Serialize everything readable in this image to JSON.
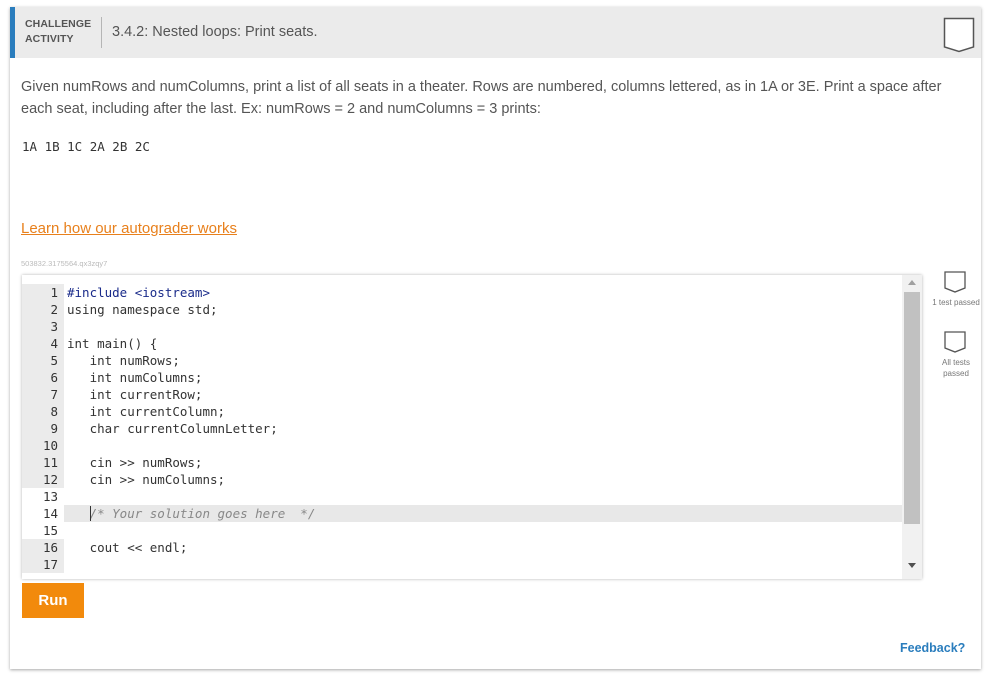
{
  "header": {
    "activity_type": "CHALLENGE ACTIVITY",
    "title": "3.4.2: Nested loops: Print seats.",
    "accent_color": "#2a7dbd"
  },
  "prompt": {
    "text": "Given numRows and numColumns, print a list of all seats in a theater. Rows are numbered, columns lettered, as in 1A or 3E. Print a space after each seat, including after the last. Ex: numRows = 2 and numColumns = 3 prints:",
    "example_output": "1A 1B 1C 2A 2B 2C",
    "learn_link": "Learn how our autograder works",
    "challenge_id": "503832.3175564.qx3zqy7"
  },
  "editor": {
    "lines": [
      {
        "num": "1",
        "text": "#include <iostream>"
      },
      {
        "num": "2",
        "text": "using namespace std;"
      },
      {
        "num": "3",
        "text": ""
      },
      {
        "num": "4",
        "text": "int main() {"
      },
      {
        "num": "5",
        "text": "   int numRows;"
      },
      {
        "num": "6",
        "text": "   int numColumns;"
      },
      {
        "num": "7",
        "text": "   int currentRow;"
      },
      {
        "num": "8",
        "text": "   int currentColumn;"
      },
      {
        "num": "9",
        "text": "   char currentColumnLetter;"
      },
      {
        "num": "10",
        "text": ""
      },
      {
        "num": "11",
        "text": "   cin >> numRows;"
      },
      {
        "num": "12",
        "text": "   cin >> numColumns;"
      },
      {
        "num": "13",
        "text": ""
      },
      {
        "num": "14",
        "text": "   /* Your solution goes here  */"
      },
      {
        "num": "15",
        "text": ""
      },
      {
        "num": "16",
        "text": "   cout << endl;"
      },
      {
        "num": "17",
        "text": ""
      }
    ]
  },
  "tests": {
    "one_test_label": "1 test passed",
    "all_tests_label": "All tests passed"
  },
  "actions": {
    "run_label": "Run",
    "feedback_label": "Feedback?"
  },
  "colors": {
    "run_button": "#f28a0c",
    "link": "#e8801c",
    "feedback": "#2a7dbd"
  }
}
